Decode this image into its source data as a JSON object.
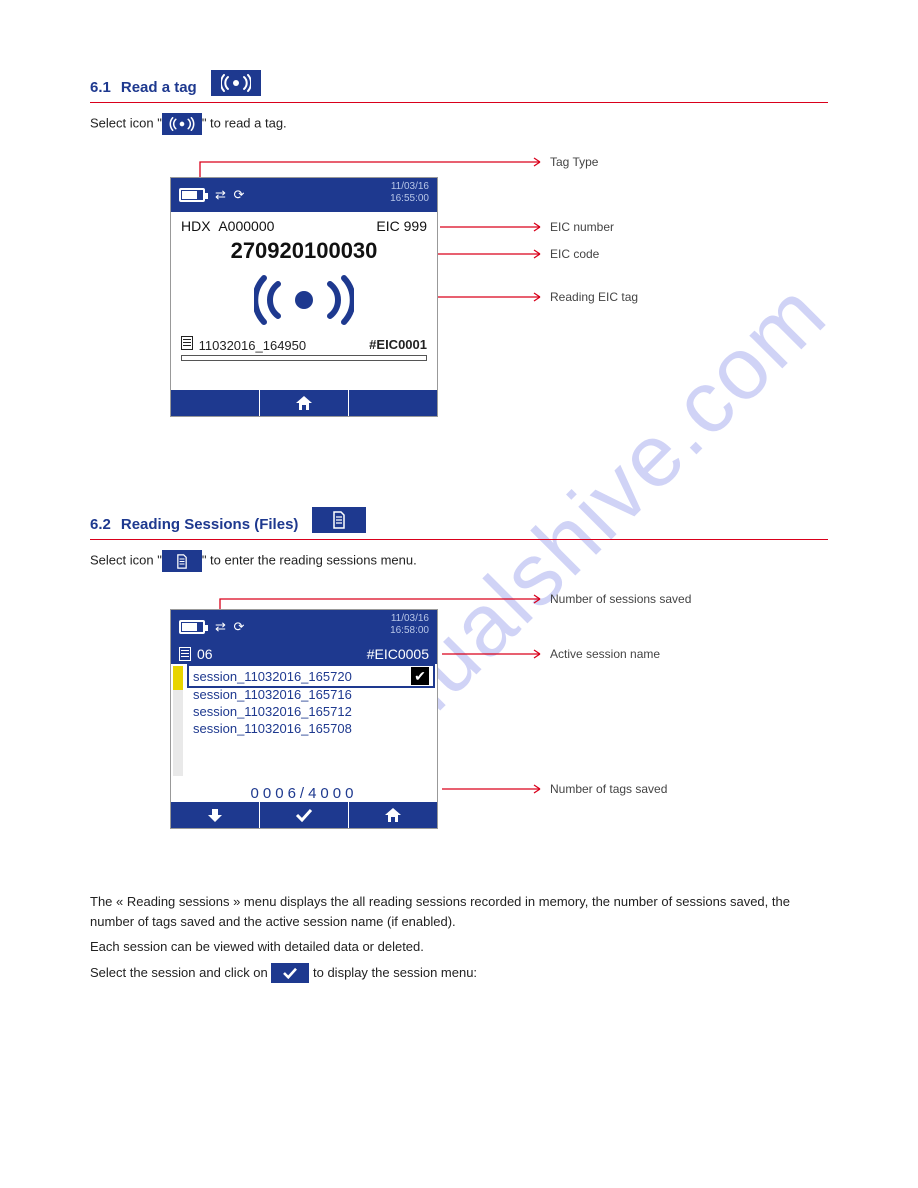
{
  "watermark": "manualshive.com",
  "sec1": {
    "num": "6.1",
    "title": "Read a tag"
  },
  "sec1_text1_a": "Select icon \"",
  "sec1_text1_b": "\" to read a tag.",
  "sec2": {
    "num": "6.2",
    "title": "Reading Sessions  (Files)"
  },
  "sec2_text1_a": "Select icon \"",
  "sec2_text1_b": "\" to enter the reading sessions menu.",
  "sec2_para1": "The « Reading sessions » menu displays the all reading sessions recorded in memory, the number of sessions saved, the number of tags saved and the active session name (if enabled).",
  "sec2_para2": "Each session can be viewed with detailed data or deleted.",
  "sec2_para3_a": "Select the session and click on ",
  "sec2_para3_b": " to display the session menu:",
  "callouts1": {
    "a": "Tag Type",
    "b": "EIC number",
    "c": "EIC code",
    "d": "Reading EIC tag"
  },
  "callouts2": {
    "a": "Number of sessions saved",
    "b": "Active session name",
    "c": "Number of tags saved"
  },
  "screen1": {
    "date": "11/03/16",
    "time": "16:55:00",
    "hdx": "HDX",
    "a0": "A000000",
    "eic_label": "EIC 999",
    "big": "270920100030",
    "session": "11032016_164950",
    "eic_code": "#EIC0001"
  },
  "screen2": {
    "date": "11/03/16",
    "time": "16:58:00",
    "count_label": "06",
    "active": "#EIC0005",
    "items": [
      "session_11032016_165720",
      "session_11032016_165716",
      "session_11032016_165712",
      "session_11032016_165708"
    ],
    "counter": "0006/4000"
  }
}
